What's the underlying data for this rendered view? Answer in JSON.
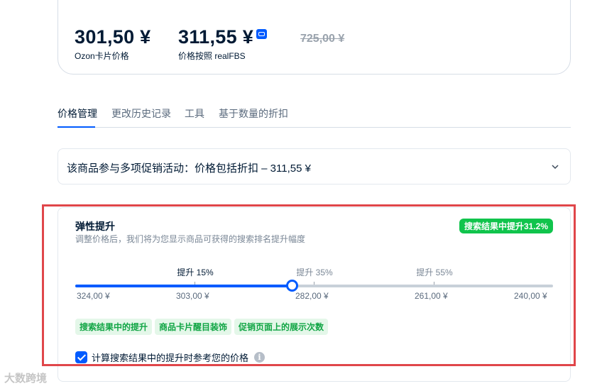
{
  "price_card": {
    "ozon_price": "301,50 ¥",
    "ozon_label": "Ozon卡片价格",
    "fbs_price": "311,55 ¥",
    "fbs_label": "价格按照 realFBS",
    "old_price": "725,00 ¥",
    "fbs_icon": "realfbs-badge-icon"
  },
  "tabs": [
    {
      "label": "价格管理",
      "active": true
    },
    {
      "label": "更改历史记录",
      "active": false
    },
    {
      "label": "工具",
      "active": false
    },
    {
      "label": "基于数量的折扣",
      "active": false
    }
  ],
  "promo": {
    "text": "该商品参与多项促销活动：价格包括折扣 – 311,55 ¥",
    "icon": "chevron-down-icon"
  },
  "elastic_boost": {
    "title": "弹性提升",
    "subtitle": "调整价格后，我们将为您显示商品可获得的搜索排名提升幅度",
    "badge": "搜索结果中提升31.2%",
    "slider": {
      "value_fraction": 0.453,
      "ticks": [
        "324,00 ¥",
        "303,00 ¥",
        "282,00 ¥",
        "261,00 ¥",
        "240,00 ¥"
      ],
      "steps": [
        {
          "label": "提升 15%",
          "current": true
        },
        {
          "label": "提升 35%",
          "current": false
        },
        {
          "label": "提升 55%",
          "current": false
        }
      ]
    },
    "chips": [
      "搜索结果中的提升",
      "商品卡片醒目装饰",
      "促销页面上的展示次数"
    ],
    "checkbox": {
      "label": "计算搜索结果中的提升时参考您的价格",
      "checked": true
    },
    "info_icon": "info-icon"
  },
  "watermark": "大数跨境",
  "colors": {
    "accent": "#005bff",
    "success": "#10c44c",
    "highlight_frame": "#e0464a"
  }
}
